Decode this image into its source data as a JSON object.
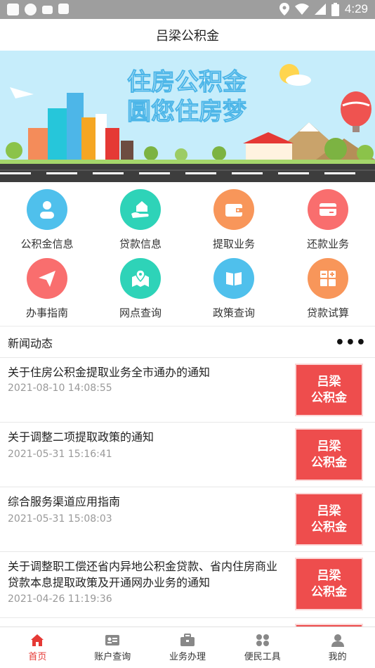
{
  "status_bar": {
    "time": "4:29"
  },
  "header": {
    "title": "吕梁公积金"
  },
  "banner": {
    "line1": "住房公积金",
    "line2": "圆您住房梦"
  },
  "grid": {
    "items": [
      {
        "label": "公积金信息",
        "color": "#4fc0ec",
        "icon": "person-icon"
      },
      {
        "label": "贷款信息",
        "color": "#2ed3b8",
        "icon": "hand-house-icon"
      },
      {
        "label": "提取业务",
        "color": "#f8965a",
        "icon": "wallet-icon"
      },
      {
        "label": "还款业务",
        "color": "#f96e6e",
        "icon": "card-icon"
      },
      {
        "label": "办事指南",
        "color": "#f96e6e",
        "icon": "paper-plane-icon"
      },
      {
        "label": "网点查询",
        "color": "#2ed3b8",
        "icon": "map-pin-icon"
      },
      {
        "label": "政策查询",
        "color": "#4fc0ec",
        "icon": "book-icon"
      },
      {
        "label": "贷款试算",
        "color": "#f8965a",
        "icon": "calculator-icon"
      }
    ]
  },
  "news": {
    "title": "新闻动态",
    "more": "•••",
    "thumb_line1": "吕梁",
    "thumb_line2": "公积金",
    "items": [
      {
        "title": "关于住房公积金提取业务全市通办的通知",
        "date": "2021-08-10 14:08:55"
      },
      {
        "title": "关于调整二项提取政策的通知",
        "date": "2021-05-31 15:16:41"
      },
      {
        "title": "综合服务渠道应用指南",
        "date": "2021-05-31 15:08:03"
      },
      {
        "title": "关于调整职工偿还省内异地公积金贷款、省内住房商业贷款本息提取政策及开通网办业务的通知",
        "date": "2021-04-26 11:19:36"
      }
    ]
  },
  "tabbar": {
    "items": [
      {
        "label": "首页",
        "icon": "home-icon"
      },
      {
        "label": "账户查询",
        "icon": "id-card-icon"
      },
      {
        "label": "业务办理",
        "icon": "briefcase-icon"
      },
      {
        "label": "便民工具",
        "icon": "apps-icon"
      },
      {
        "label": "我的",
        "icon": "user-icon"
      }
    ],
    "active_color": "#e53935",
    "inactive_color": "#888888"
  }
}
